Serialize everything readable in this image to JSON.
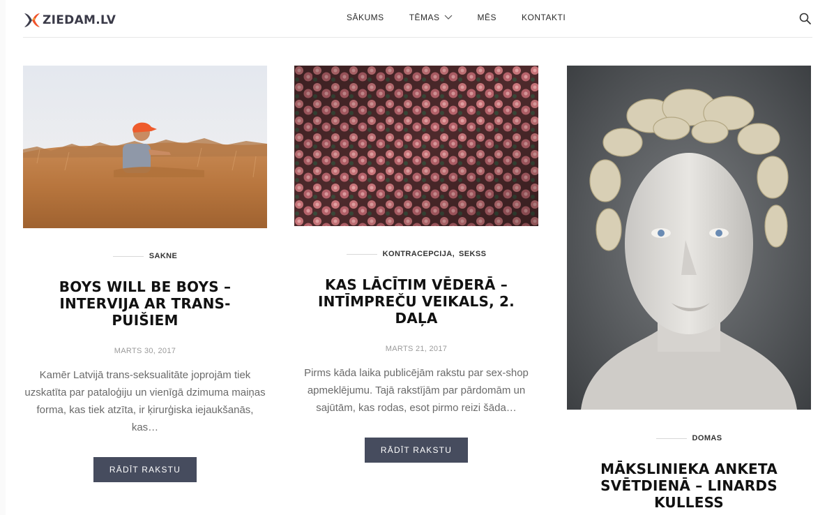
{
  "brand": {
    "name": "ZIEDAM.LV"
  },
  "nav": [
    {
      "label": "SĀKUMS"
    },
    {
      "label": "TĒMAS",
      "has_dropdown": true
    },
    {
      "label": "MĒS"
    },
    {
      "label": "KONTAKTI"
    }
  ],
  "search": {
    "icon": "search-icon"
  },
  "posts": [
    {
      "categories": [
        "SAKNE"
      ],
      "title": "BOYS WILL BE BOYS – INTERVIJA AR TRANS-PUIŠIEM",
      "date": "MARTS 30, 2017",
      "excerpt": "Kamēr Latvijā trans-seksualitāte joprojām tiek uzskatīta par pataloģiju un vienīgā dzimuma maiņas forma, kas tiek atzīta, ir ķirurģiska iejaukšanās, kas…",
      "button": "RĀDĪT RAKSTU"
    },
    {
      "categories": [
        "KONTRACEPCIJA,",
        "SEKSS"
      ],
      "title": "KAS LĀCĪTIM VĒDERĀ – INTĪMPREČU VEIKALS, 2. DAĻA",
      "date": "MARTS 21, 2017",
      "excerpt": "Pirms kāda laika publicējām rakstu par sex-shop apmeklējumu. Tajā rakstījām par pārdomām un sajūtām, kas rodas, esot pirmo reizi šāda…",
      "button": "RĀDĪT RAKSTU"
    },
    {
      "categories": [
        "DOMAS"
      ],
      "title": "MĀKSLINIEKA ANKETA SVĒTDIENĀ – LINARDS KULLESS"
    }
  ],
  "colors": {
    "button_bg": "#464c5e",
    "accent": "#f0522a"
  }
}
